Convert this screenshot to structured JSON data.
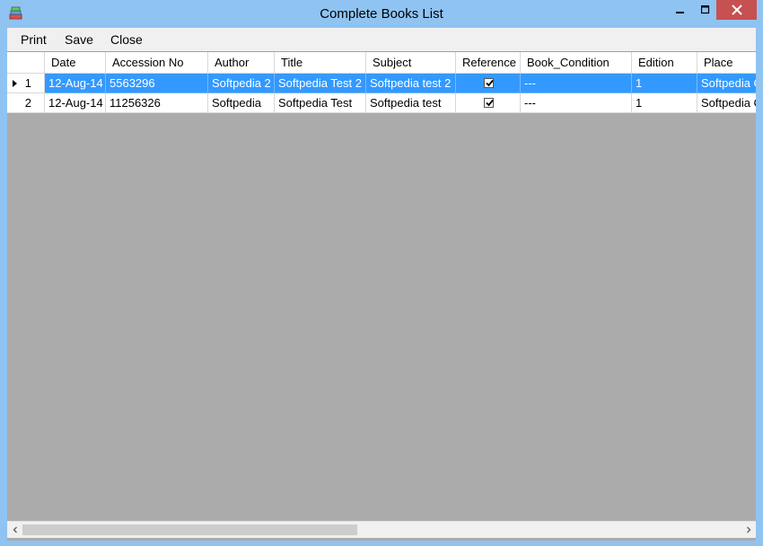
{
  "window": {
    "title": "Complete Books List",
    "icon": "books-icon",
    "controls": {
      "minimize": "minimize-icon",
      "maximize": "maximize-icon",
      "close": "close-icon"
    }
  },
  "menu": {
    "print": "Print",
    "save": "Save",
    "close": "Close"
  },
  "table": {
    "columns": [
      "Date",
      "Accession No",
      "Author",
      "Title",
      "Subject",
      "Reference",
      "Book_Condition",
      "Edition",
      "Place"
    ],
    "rows": [
      {
        "row_number": "1",
        "selected": true,
        "date": "12-Aug-14",
        "accession_no": "5563296",
        "author": "Softpedia 2",
        "title": "Softpedia Test 2",
        "subject": "Softpedia test 2",
        "reference": true,
        "book_condition": "---",
        "edition": "1",
        "place": "Softpedia C"
      },
      {
        "row_number": "2",
        "selected": false,
        "date": "12-Aug-14",
        "accession_no": "11256326",
        "author": "Softpedia",
        "title": "Softpedia Test",
        "subject": "Softpedia test",
        "reference": true,
        "book_condition": "---",
        "edition": "1",
        "place": "Softpedia C"
      }
    ]
  },
  "colors": {
    "titlebar": "#8fc3f1",
    "selection": "#3399ff",
    "grid_background": "#ababab"
  }
}
